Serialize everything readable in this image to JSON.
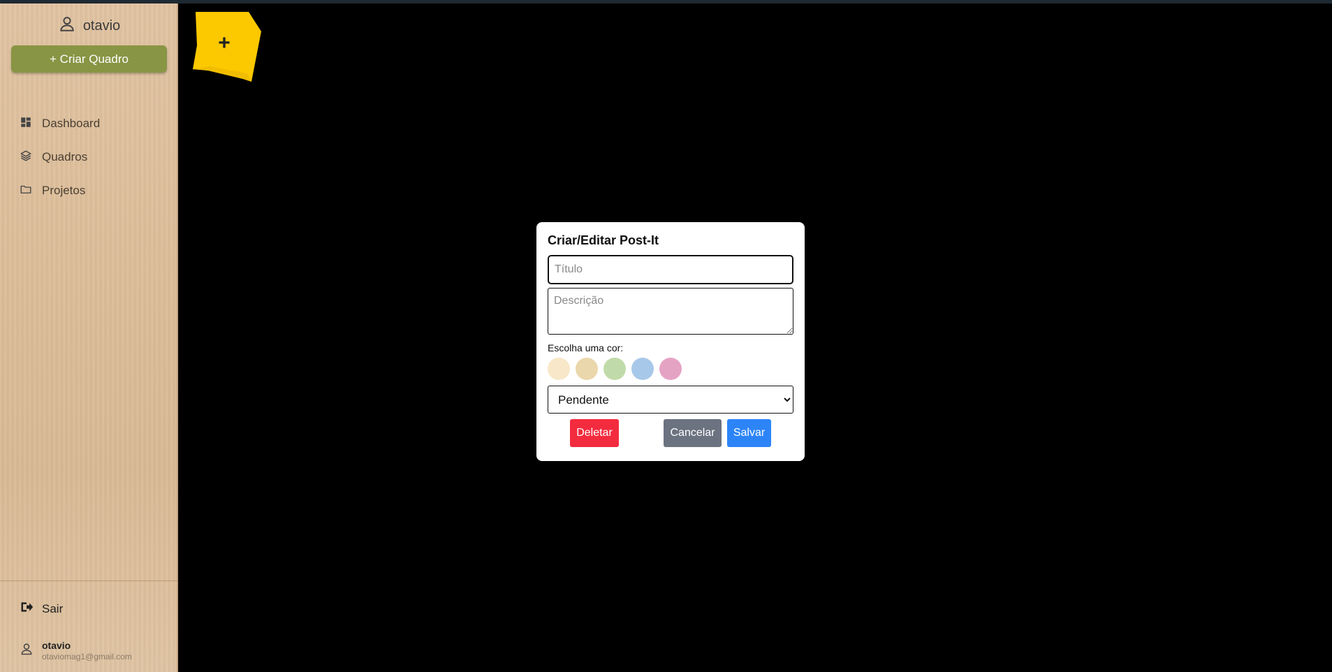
{
  "sidebar": {
    "username": "otavio",
    "create_board_label": "+ Criar Quadro",
    "nav": [
      {
        "label": "Dashboard",
        "icon": "dashboard-icon"
      },
      {
        "label": "Quadros",
        "icon": "layers-icon"
      },
      {
        "label": "Projetos",
        "icon": "folder-icon"
      }
    ],
    "logout_label": "Sair",
    "footer": {
      "name": "otavio",
      "email": "otaviomag1@gmail.com"
    }
  },
  "board": {
    "add_postit_label": "+",
    "add_postit_color": "#fcc800"
  },
  "modal": {
    "title": "Criar/Editar Post-It",
    "title_placeholder": "Título",
    "description_placeholder": "Descrição",
    "color_label": "Escolha uma cor:",
    "colors": [
      "#f8e7c8",
      "#ead7ab",
      "#c0dba9",
      "#a8c8e9",
      "#e5a3c4"
    ],
    "status_options": [
      "Pendente"
    ],
    "status_selected": "Pendente",
    "delete_label": "Deletar",
    "cancel_label": "Cancelar",
    "save_label": "Salvar"
  }
}
